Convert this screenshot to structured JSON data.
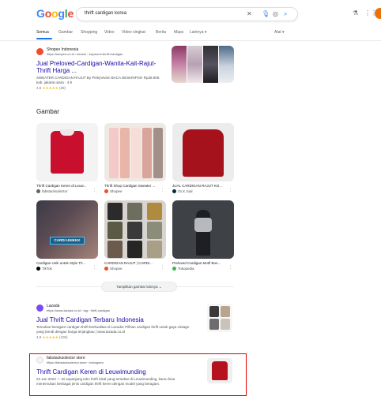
{
  "search": {
    "query": "thrift cardigan korea"
  },
  "tabs": {
    "items": [
      "Semua",
      "Gambar",
      "Shopping",
      "Video",
      "Video singkat",
      "Berita",
      "Maps",
      "Lainnya ▾"
    ],
    "tools": "Alat ▾"
  },
  "results": [
    {
      "site": "Shopee Indonesia",
      "url": "https://shopee.co.id › search › keyword=thrift+cardigan",
      "title": "Jual Preloved-Cardigan-Wanita-Kait-Rajut-Thrift Harga ...",
      "snippet": "SWEATER CARDIGAN RAJUT By PinkyVivien BACA DESKRIPSI!! Rp38.900. kab. jakarta utara · 4.9",
      "rating": "4,9",
      "reviews": "(38)"
    },
    {
      "site": "Lazada",
      "url": "https://www.lazada.co.id › tag › thrift-cardigan",
      "title": "Jual Thrift Cardigan Terbaru Indonesia",
      "snippet": "Temukan beragam cardigan thrift berkualitas di Lazada! Pilihan cardigan thrift untuk gaya vintage yang trendi dengan harga terjangkau | www.lazada.co.id",
      "rating": "4,9",
      "reviews": "(100)"
    },
    {
      "site": "fabstacksolector store",
      "url": "https://fabstacksolector.store › instagram",
      "title": "Thrift Cardigan Keren di Leuwimunding",
      "snippet": "23 Jun 2023 — Di sepanjang toko thrift lokal yang tersebar di Leuwimunding, kamu bisa menemukan berbagai jenis cardigan thrift keren dengan model yang beragam."
    }
  ],
  "images": {
    "heading": "Gambar",
    "cards": [
      {
        "caption": "Thrift Cardigan Keren di Leuw...",
        "source": "fabstacksolector"
      },
      {
        "caption": "Thrift Shop Cardigan Sweater ...",
        "source": "Shopee"
      },
      {
        "caption": "JUAL CARDIGAN RAJUT KO...",
        "source": "OLX Jual"
      },
      {
        "caption": "Cardigan Unik untuk Style Th...",
        "source": "TikTok",
        "banner": "CARDI UNIKKK"
      },
      {
        "caption": "CARDIGAN RAJUT | CARDI...",
        "source": "Shopee"
      },
      {
        "caption": "Preloved Cardigan Motif Bun...",
        "source": "Tokopedia"
      }
    ],
    "more_button": "Tampilkan gambar lainnya ⌄"
  },
  "colors": {
    "link": "#1a0dab",
    "accent": "#1a73e8",
    "highlight_border": "#e00000"
  }
}
